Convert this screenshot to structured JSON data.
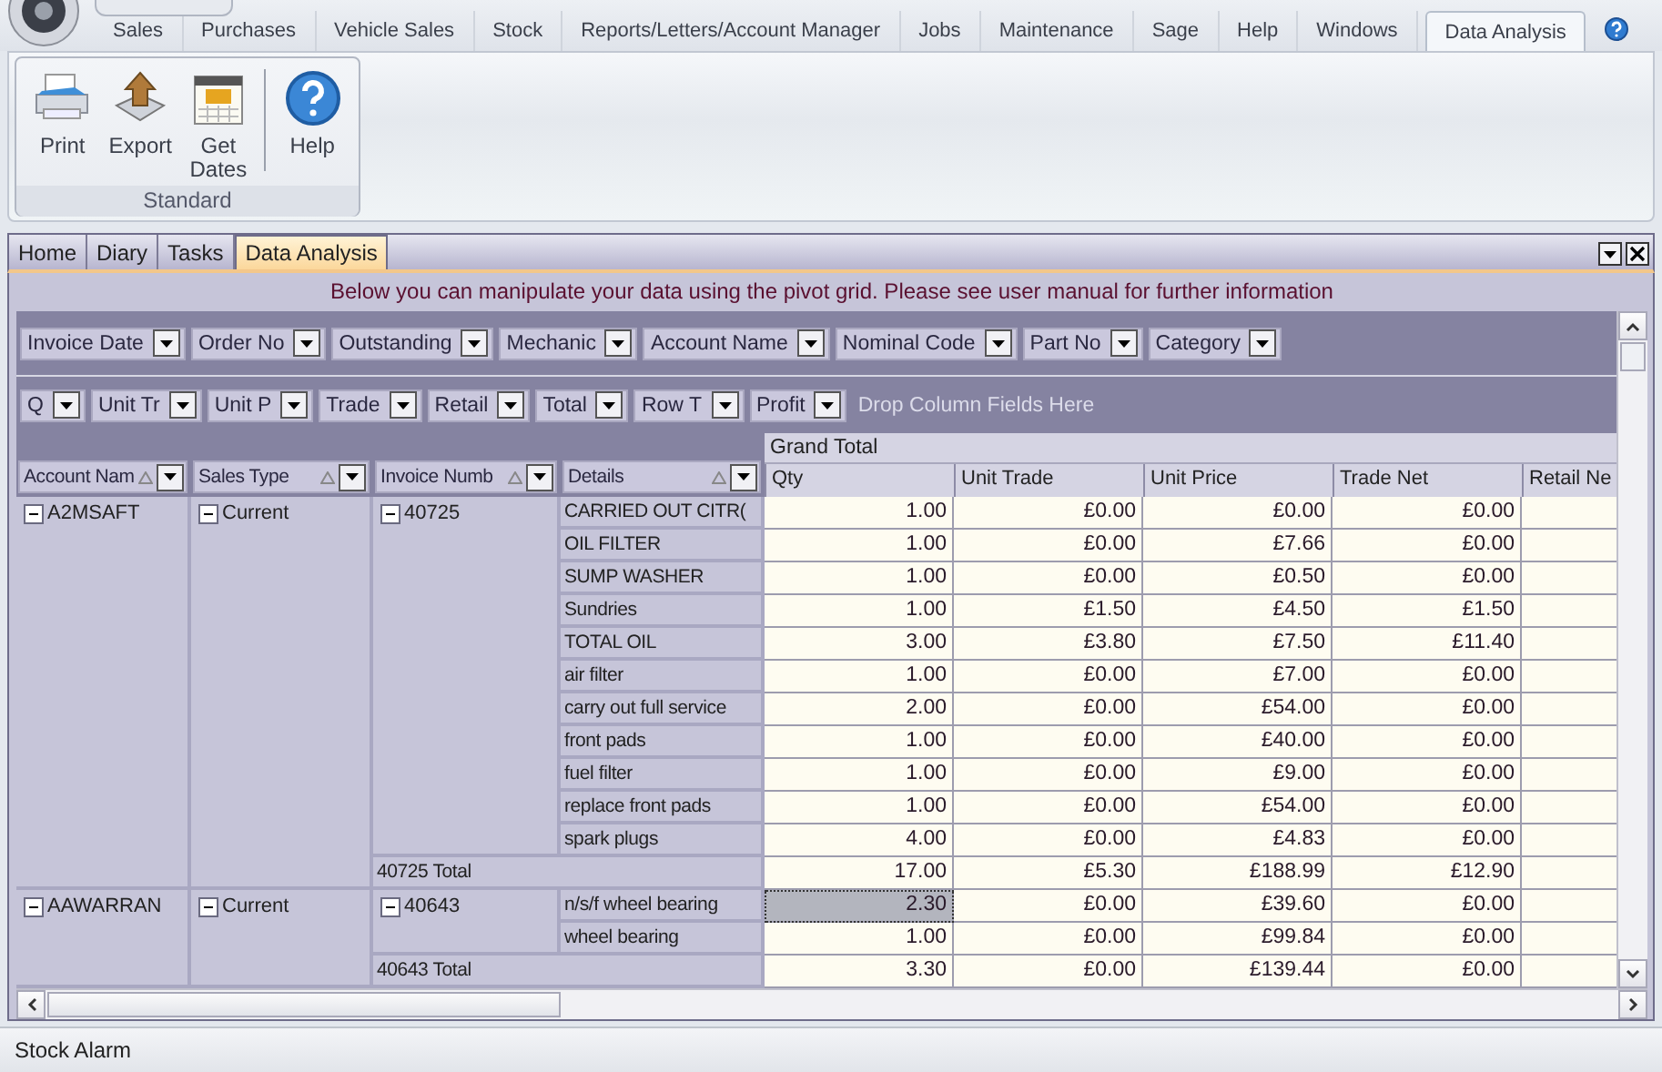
{
  "ribbon_tabs": [
    {
      "label": "Sales",
      "selected": false
    },
    {
      "label": "Purchases",
      "selected": false
    },
    {
      "label": "Vehicle Sales",
      "selected": false
    },
    {
      "label": "Stock",
      "selected": false
    },
    {
      "label": "Reports/Letters/Account Manager",
      "selected": false
    },
    {
      "label": "Jobs",
      "selected": false
    },
    {
      "label": "Maintenance",
      "selected": false
    },
    {
      "label": "Sage",
      "selected": false
    },
    {
      "label": "Help",
      "selected": false
    },
    {
      "label": "Windows",
      "selected": false
    },
    {
      "label": "Data Analysis",
      "selected": true
    }
  ],
  "ribbon_group": {
    "title": "Standard",
    "buttons": [
      {
        "kind": "print",
        "label": "Print"
      },
      {
        "kind": "export",
        "label": "Export"
      },
      {
        "kind": "calendar",
        "label": "Get Dates"
      },
      {
        "kind": "help",
        "label": "Help"
      }
    ]
  },
  "document_tabs": [
    {
      "label": "Home",
      "selected": false
    },
    {
      "label": "Diary",
      "selected": false
    },
    {
      "label": "Tasks",
      "selected": false
    },
    {
      "label": "Data Analysis",
      "selected": true
    }
  ],
  "pivot": {
    "info": "Below you can manipulate your data using the pivot grid.  Please see user manual for further information",
    "filter_fields": [
      "Invoice Date",
      "Order No",
      "Outstanding",
      "Mechanic",
      "Account Name",
      "Nominal Code",
      "Part No",
      "Category"
    ],
    "data_fields": [
      "Q",
      "Unit Tr",
      "Unit P",
      "Trade",
      "Retail",
      "Total",
      "Row T",
      "Profit"
    ],
    "drop_hint": "Drop Column Fields Here",
    "grand_total": "Grand Total",
    "row_fields": [
      "Account Nam",
      "Sales Type",
      "Invoice Numb",
      "Details"
    ],
    "columns": [
      "Qty",
      "Unit Trade",
      "Unit Price",
      "Trade Net",
      "Retail Ne"
    ],
    "accounts": [
      {
        "name": "A2MSAFT",
        "sales_type": "Current",
        "expanded": true,
        "sales_type_expanded": true,
        "invoices": [
          {
            "number": "40725",
            "expanded": true,
            "details": [
              {
                "name": "CARRIED OUT CITR(",
                "values": [
                  "1.00",
                  "£0.00",
                  "£0.00",
                  "£0.00"
                ],
                "selected": false
              },
              {
                "name": "OIL FILTER",
                "values": [
                  "1.00",
                  "£0.00",
                  "£7.66",
                  "£0.00"
                ],
                "selected": false
              },
              {
                "name": "SUMP WASHER",
                "values": [
                  "1.00",
                  "£0.00",
                  "£0.50",
                  "£0.00"
                ],
                "selected": false
              },
              {
                "name": "Sundries",
                "values": [
                  "1.00",
                  "£1.50",
                  "£4.50",
                  "£1.50"
                ],
                "selected": false
              },
              {
                "name": "TOTAL OIL",
                "values": [
                  "3.00",
                  "£3.80",
                  "£7.50",
                  "£11.40"
                ],
                "selected": false
              },
              {
                "name": "air filter",
                "values": [
                  "1.00",
                  "£0.00",
                  "£7.00",
                  "£0.00"
                ],
                "selected": false
              },
              {
                "name": "carry out full service",
                "values": [
                  "2.00",
                  "£0.00",
                  "£54.00",
                  "£0.00"
                ],
                "selected": false
              },
              {
                "name": "front pads",
                "values": [
                  "1.00",
                  "£0.00",
                  "£40.00",
                  "£0.00"
                ],
                "selected": false
              },
              {
                "name": "fuel filter",
                "values": [
                  "1.00",
                  "£0.00",
                  "£9.00",
                  "£0.00"
                ],
                "selected": false
              },
              {
                "name": "replace front pads",
                "values": [
                  "1.00",
                  "£0.00",
                  "£54.00",
                  "£0.00"
                ],
                "selected": false
              },
              {
                "name": "spark plugs",
                "values": [
                  "4.00",
                  "£0.00",
                  "£4.83",
                  "£0.00"
                ],
                "selected": false
              }
            ],
            "total": {
              "label": "40725 Total",
              "values": [
                "17.00",
                "£5.30",
                "£188.99",
                "£12.90"
              ]
            }
          }
        ]
      },
      {
        "name": "AAWARRAN",
        "sales_type": "Current",
        "expanded": true,
        "sales_type_expanded": true,
        "invoices": [
          {
            "number": "40643",
            "expanded": true,
            "details": [
              {
                "name": "n/s/f wheel bearing",
                "values": [
                  "2.30",
                  "£0.00",
                  "£39.60",
                  "£0.00"
                ],
                "selected": true
              },
              {
                "name": "wheel bearing",
                "values": [
                  "1.00",
                  "£0.00",
                  "£99.84",
                  "£0.00"
                ],
                "selected": false
              }
            ],
            "total": {
              "label": "40643 Total",
              "values": [
                "3.30",
                "£0.00",
                "£139.44",
                "£0.00"
              ]
            }
          }
        ]
      }
    ]
  },
  "status_bar": "Stock Alarm"
}
